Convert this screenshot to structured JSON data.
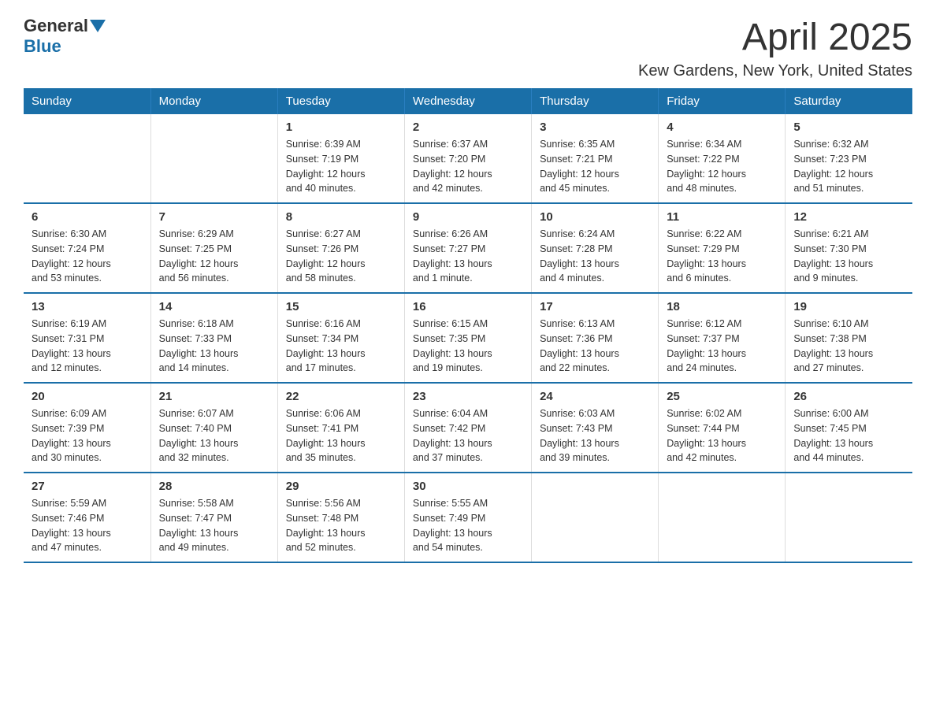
{
  "logo": {
    "general": "General",
    "blue": "Blue"
  },
  "title": {
    "month": "April 2025",
    "location": "Kew Gardens, New York, United States"
  },
  "header_days": [
    "Sunday",
    "Monday",
    "Tuesday",
    "Wednesday",
    "Thursday",
    "Friday",
    "Saturday"
  ],
  "weeks": [
    [
      {
        "day": "",
        "info": ""
      },
      {
        "day": "",
        "info": ""
      },
      {
        "day": "1",
        "info": "Sunrise: 6:39 AM\nSunset: 7:19 PM\nDaylight: 12 hours\nand 40 minutes."
      },
      {
        "day": "2",
        "info": "Sunrise: 6:37 AM\nSunset: 7:20 PM\nDaylight: 12 hours\nand 42 minutes."
      },
      {
        "day": "3",
        "info": "Sunrise: 6:35 AM\nSunset: 7:21 PM\nDaylight: 12 hours\nand 45 minutes."
      },
      {
        "day": "4",
        "info": "Sunrise: 6:34 AM\nSunset: 7:22 PM\nDaylight: 12 hours\nand 48 minutes."
      },
      {
        "day": "5",
        "info": "Sunrise: 6:32 AM\nSunset: 7:23 PM\nDaylight: 12 hours\nand 51 minutes."
      }
    ],
    [
      {
        "day": "6",
        "info": "Sunrise: 6:30 AM\nSunset: 7:24 PM\nDaylight: 12 hours\nand 53 minutes."
      },
      {
        "day": "7",
        "info": "Sunrise: 6:29 AM\nSunset: 7:25 PM\nDaylight: 12 hours\nand 56 minutes."
      },
      {
        "day": "8",
        "info": "Sunrise: 6:27 AM\nSunset: 7:26 PM\nDaylight: 12 hours\nand 58 minutes."
      },
      {
        "day": "9",
        "info": "Sunrise: 6:26 AM\nSunset: 7:27 PM\nDaylight: 13 hours\nand 1 minute."
      },
      {
        "day": "10",
        "info": "Sunrise: 6:24 AM\nSunset: 7:28 PM\nDaylight: 13 hours\nand 4 minutes."
      },
      {
        "day": "11",
        "info": "Sunrise: 6:22 AM\nSunset: 7:29 PM\nDaylight: 13 hours\nand 6 minutes."
      },
      {
        "day": "12",
        "info": "Sunrise: 6:21 AM\nSunset: 7:30 PM\nDaylight: 13 hours\nand 9 minutes."
      }
    ],
    [
      {
        "day": "13",
        "info": "Sunrise: 6:19 AM\nSunset: 7:31 PM\nDaylight: 13 hours\nand 12 minutes."
      },
      {
        "day": "14",
        "info": "Sunrise: 6:18 AM\nSunset: 7:33 PM\nDaylight: 13 hours\nand 14 minutes."
      },
      {
        "day": "15",
        "info": "Sunrise: 6:16 AM\nSunset: 7:34 PM\nDaylight: 13 hours\nand 17 minutes."
      },
      {
        "day": "16",
        "info": "Sunrise: 6:15 AM\nSunset: 7:35 PM\nDaylight: 13 hours\nand 19 minutes."
      },
      {
        "day": "17",
        "info": "Sunrise: 6:13 AM\nSunset: 7:36 PM\nDaylight: 13 hours\nand 22 minutes."
      },
      {
        "day": "18",
        "info": "Sunrise: 6:12 AM\nSunset: 7:37 PM\nDaylight: 13 hours\nand 24 minutes."
      },
      {
        "day": "19",
        "info": "Sunrise: 6:10 AM\nSunset: 7:38 PM\nDaylight: 13 hours\nand 27 minutes."
      }
    ],
    [
      {
        "day": "20",
        "info": "Sunrise: 6:09 AM\nSunset: 7:39 PM\nDaylight: 13 hours\nand 30 minutes."
      },
      {
        "day": "21",
        "info": "Sunrise: 6:07 AM\nSunset: 7:40 PM\nDaylight: 13 hours\nand 32 minutes."
      },
      {
        "day": "22",
        "info": "Sunrise: 6:06 AM\nSunset: 7:41 PM\nDaylight: 13 hours\nand 35 minutes."
      },
      {
        "day": "23",
        "info": "Sunrise: 6:04 AM\nSunset: 7:42 PM\nDaylight: 13 hours\nand 37 minutes."
      },
      {
        "day": "24",
        "info": "Sunrise: 6:03 AM\nSunset: 7:43 PM\nDaylight: 13 hours\nand 39 minutes."
      },
      {
        "day": "25",
        "info": "Sunrise: 6:02 AM\nSunset: 7:44 PM\nDaylight: 13 hours\nand 42 minutes."
      },
      {
        "day": "26",
        "info": "Sunrise: 6:00 AM\nSunset: 7:45 PM\nDaylight: 13 hours\nand 44 minutes."
      }
    ],
    [
      {
        "day": "27",
        "info": "Sunrise: 5:59 AM\nSunset: 7:46 PM\nDaylight: 13 hours\nand 47 minutes."
      },
      {
        "day": "28",
        "info": "Sunrise: 5:58 AM\nSunset: 7:47 PM\nDaylight: 13 hours\nand 49 minutes."
      },
      {
        "day": "29",
        "info": "Sunrise: 5:56 AM\nSunset: 7:48 PM\nDaylight: 13 hours\nand 52 minutes."
      },
      {
        "day": "30",
        "info": "Sunrise: 5:55 AM\nSunset: 7:49 PM\nDaylight: 13 hours\nand 54 minutes."
      },
      {
        "day": "",
        "info": ""
      },
      {
        "day": "",
        "info": ""
      },
      {
        "day": "",
        "info": ""
      }
    ]
  ]
}
